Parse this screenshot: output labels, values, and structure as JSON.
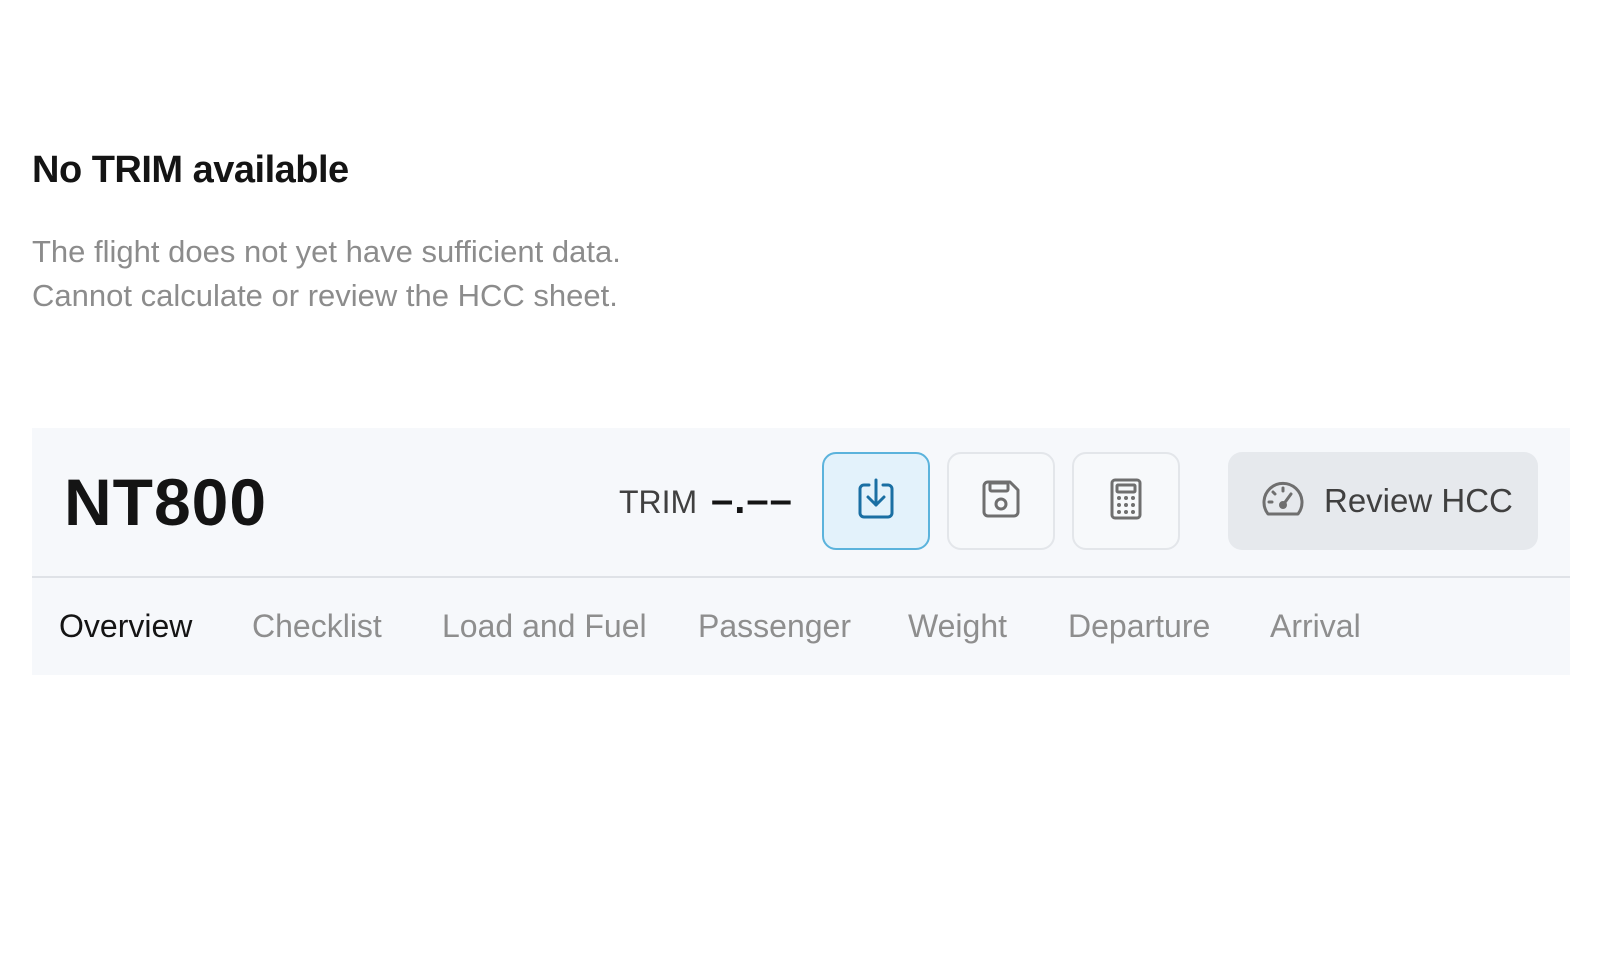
{
  "notice": {
    "title": "No TRIM available",
    "line1": "The flight does not yet have sufficient data.",
    "line2": "Cannot calculate or review the HCC sheet."
  },
  "flight": {
    "id": "NT800",
    "trim_label": "TRIM",
    "trim_value": "–.––"
  },
  "toolbar": {
    "buttons": [
      {
        "icon": "download-icon",
        "state": "active"
      },
      {
        "icon": "save-icon",
        "state": "default"
      },
      {
        "icon": "calculator-icon",
        "state": "default"
      }
    ],
    "review": {
      "icon": "gauge-icon",
      "label": "Review HCC"
    }
  },
  "tabs": [
    {
      "label": "Overview",
      "selected": true
    },
    {
      "label": "Checklist"
    },
    {
      "label": "Load and Fuel"
    },
    {
      "label": "Passenger"
    },
    {
      "label": "Weight"
    },
    {
      "label": "Departure"
    },
    {
      "label": "Arrival"
    }
  ],
  "colors": {
    "accent": "#1a6fa3",
    "active_bg": "#e3f2fb",
    "muted_text": "#8c8c8c"
  }
}
